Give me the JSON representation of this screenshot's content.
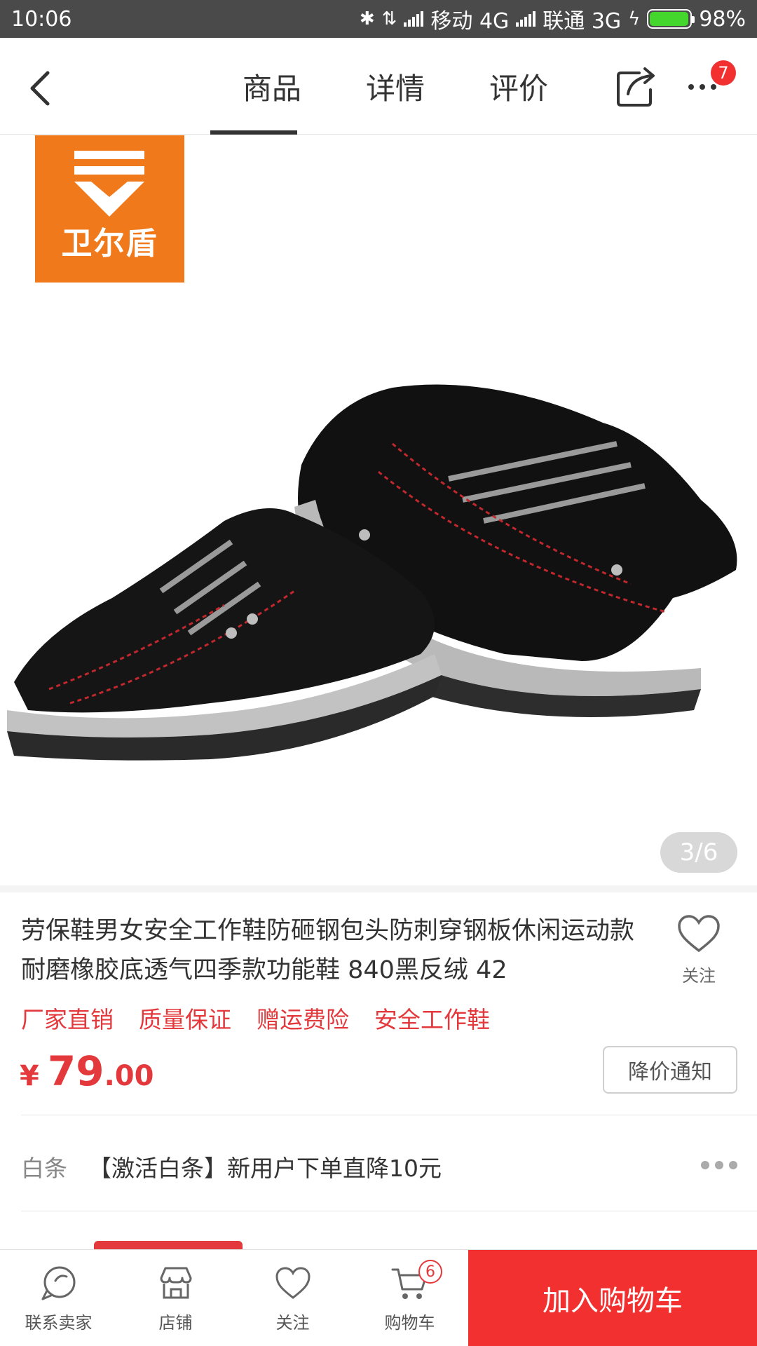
{
  "status_bar": {
    "time": "10:06",
    "carrier1": "移动 4G",
    "carrier2": "联通 3G",
    "battery": "98%"
  },
  "nav": {
    "tabs": [
      {
        "label": "商品",
        "active": true
      },
      {
        "label": "详情",
        "active": false
      },
      {
        "label": "评价",
        "active": false
      }
    ],
    "more_badge": "7"
  },
  "gallery": {
    "brand_text": "卫尔盾",
    "page_indicator": "3/6"
  },
  "product": {
    "title": "劳保鞋男女安全工作鞋防砸钢包头防刺穿钢板休闲运动款耐磨橡胶底透气四季款功能鞋 840黑反绒 42",
    "follow_label": "关注",
    "tags": [
      "厂家直销",
      "质量保证",
      "赠运费险",
      "安全工作鞋"
    ],
    "price_symbol": "¥",
    "price_int": "79",
    "price_dec": ".00",
    "notify_label": "降价通知",
    "promo_label": "白条",
    "promo_text": "【激活白条】新用户下单直降10元"
  },
  "bottom_bar": {
    "items": [
      {
        "label": "联系卖家",
        "icon": "chat-bubble-icon"
      },
      {
        "label": "店铺",
        "icon": "store-icon"
      },
      {
        "label": "关注",
        "icon": "heart-icon"
      },
      {
        "label": "购物车",
        "icon": "cart-icon"
      }
    ],
    "cart_badge": "6",
    "add_to_cart_label": "加入购物车"
  },
  "colors": {
    "accent_red": "#f23030",
    "price_red": "#e4393c",
    "brand_orange": "#f07a1b"
  }
}
